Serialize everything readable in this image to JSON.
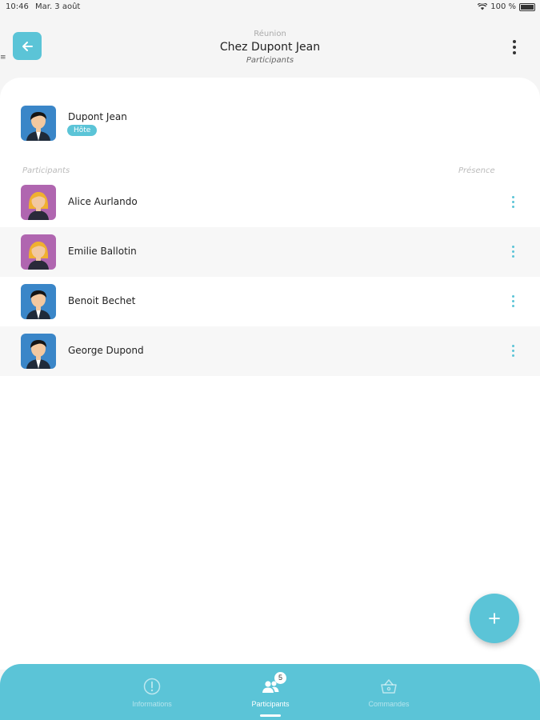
{
  "status_bar": {
    "time": "10:46",
    "date": "Mar. 3 août",
    "battery": "100 %"
  },
  "header": {
    "overline": "Réunion",
    "title": "Chez Dupont Jean",
    "subtitle": "Participants"
  },
  "host": {
    "name": "Dupont Jean",
    "badge": "Hôte",
    "avatar": "male-avatar-icon"
  },
  "list": {
    "col_participants": "Participants",
    "col_presence": "Présence"
  },
  "participants": [
    {
      "name": "Alice Aurlando",
      "avatar": "female-avatar-icon"
    },
    {
      "name": "Emilie Ballotin",
      "avatar": "female-avatar-icon"
    },
    {
      "name": "Benoit Bechet",
      "avatar": "male-avatar-icon"
    },
    {
      "name": "George Dupond",
      "avatar": "male-avatar-icon"
    }
  ],
  "bottom_nav": {
    "items": [
      {
        "label": "Informations",
        "icon": "info-icon"
      },
      {
        "label": "Participants",
        "icon": "people-icon",
        "badge": "5"
      },
      {
        "label": "Commandes",
        "icon": "basket-icon"
      }
    ],
    "active_index": 1
  },
  "colors": {
    "accent": "#5bc4d7",
    "male_avatar_bg": "#3a86c8",
    "female_avatar_bg": "#b066b0"
  }
}
